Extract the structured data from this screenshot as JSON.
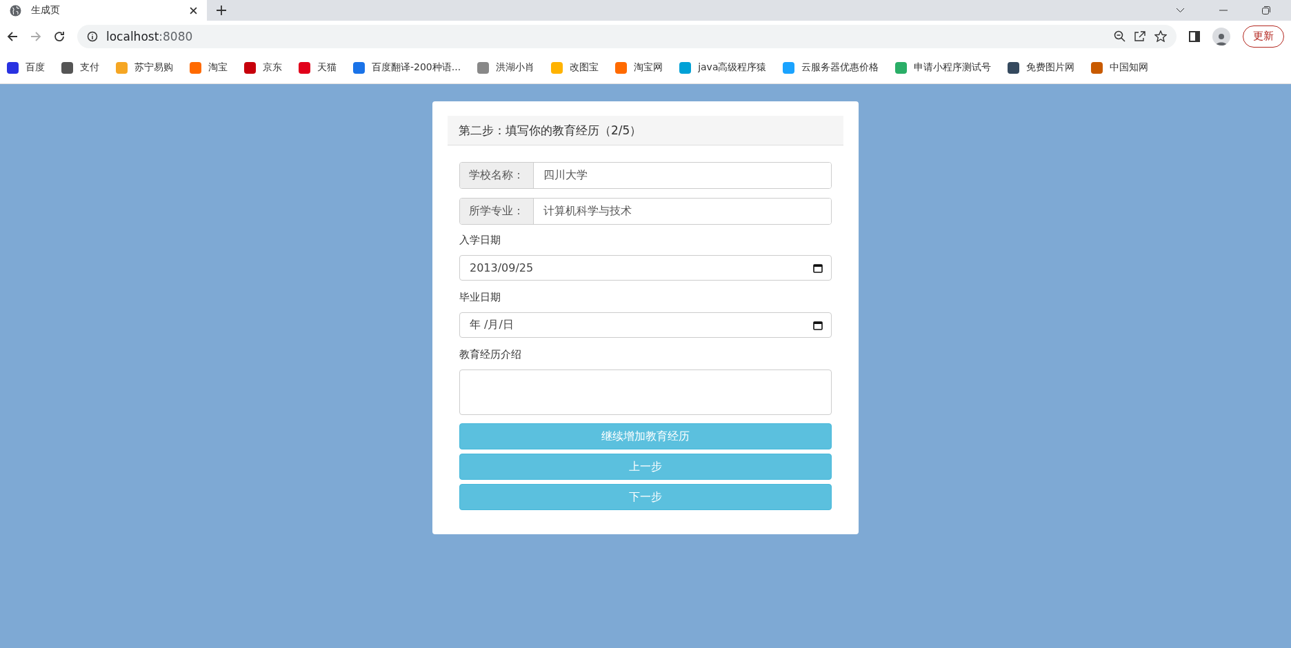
{
  "browser": {
    "tab": {
      "title": "生成页"
    },
    "address": {
      "host": "localhost",
      "port": ":8080"
    },
    "update_button": "更新"
  },
  "bookmarks": [
    {
      "label": "百度"
    },
    {
      "label": "支付"
    },
    {
      "label": "苏宁易购"
    },
    {
      "label": "淘宝"
    },
    {
      "label": "京东"
    },
    {
      "label": "天猫"
    },
    {
      "label": "百度翻译-200种语..."
    },
    {
      "label": "洪湖小肖"
    },
    {
      "label": "改图宝"
    },
    {
      "label": "淘宝网"
    },
    {
      "label": "java高级程序猿"
    },
    {
      "label": "云服务器优惠价格"
    },
    {
      "label": "申请小程序测试号"
    },
    {
      "label": "免费图片网"
    },
    {
      "label": "中国知网"
    }
  ],
  "form": {
    "title": "第二步：填写你的教育经历（2/5）",
    "fields": [
      {
        "kind": "addon",
        "label": "学校名称：",
        "value": "四川大学"
      },
      {
        "kind": "addon",
        "label": "所学专业：",
        "value": "计算机科学与技术"
      },
      {
        "kind": "date",
        "label": "入学日期",
        "value": "2013/09/25"
      },
      {
        "kind": "date",
        "label": "毕业日期",
        "placeholder": "年 /月/日"
      },
      {
        "kind": "textarea",
        "label": "教育经历介绍"
      }
    ],
    "buttons": [
      "继续增加教育经历",
      "上一步",
      "下一步"
    ]
  }
}
